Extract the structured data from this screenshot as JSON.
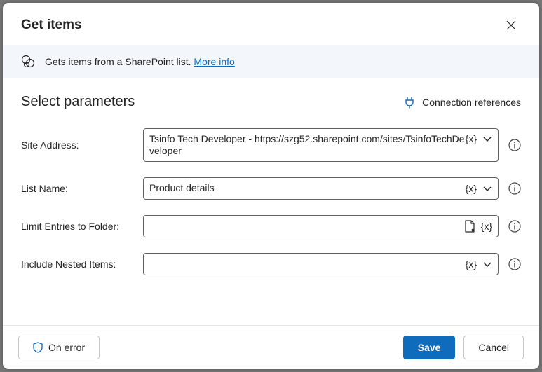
{
  "header": {
    "title": "Get items"
  },
  "info": {
    "description": "Gets items from a SharePoint list.",
    "link_label": "More info"
  },
  "params": {
    "heading": "Select parameters",
    "connection_ref": "Connection references",
    "rows": [
      {
        "label": "Site Address:",
        "value": "Tsinfo Tech Developer - https://szg52.sharepoint.com/sites/TsinfoTechDeveloper"
      },
      {
        "label": "List Name:",
        "value": "Product details"
      },
      {
        "label": "Limit Entries to Folder:",
        "value": ""
      },
      {
        "label": "Include Nested Items:",
        "value": ""
      }
    ],
    "fx_label": "{x}"
  },
  "footer": {
    "on_error": "On error",
    "save": "Save",
    "cancel": "Cancel"
  }
}
